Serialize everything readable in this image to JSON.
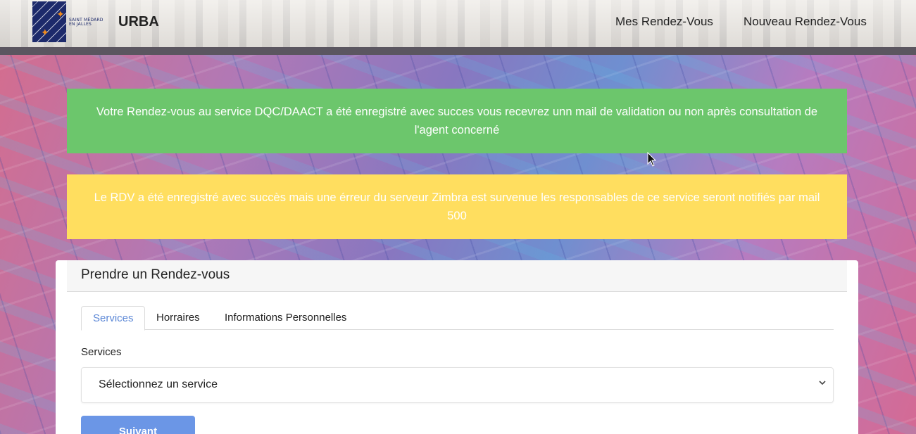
{
  "header": {
    "logo_text_line1": "SAINT MÉDARD",
    "logo_text_line2": "EN JALLES",
    "brand": "URBA",
    "nav": [
      {
        "label": "Mes Rendez-Vous"
      },
      {
        "label": "Nouveau Rendez-Vous"
      }
    ]
  },
  "alerts": {
    "success": "Votre Rendez-vous au service DQC/DAACT a été enregistré avec succes vous recevrez unn mail de validation ou non après consultation de l'agent concerné",
    "warning": "Le RDV a été enregistré avec succès mais une érreur du serveur Zimbra est survenue les responsables de ce service seront notifiés par mail 500"
  },
  "card": {
    "title": "Prendre un Rendez-vous",
    "tabs": [
      {
        "label": "Services"
      },
      {
        "label": "Horraires"
      },
      {
        "label": "Informations Personnelles"
      }
    ],
    "field_label": "Services",
    "select_value": "Sélectionnez un service",
    "next_button": "Suivant"
  },
  "colors": {
    "success": "#6cc66c",
    "warning": "#ffde5f",
    "accent": "#6b96e6",
    "active_tab": "#5b87d6"
  },
  "icons": {
    "select_chevron": "chevron-down-icon",
    "cursor": "mouse-pointer-icon"
  }
}
